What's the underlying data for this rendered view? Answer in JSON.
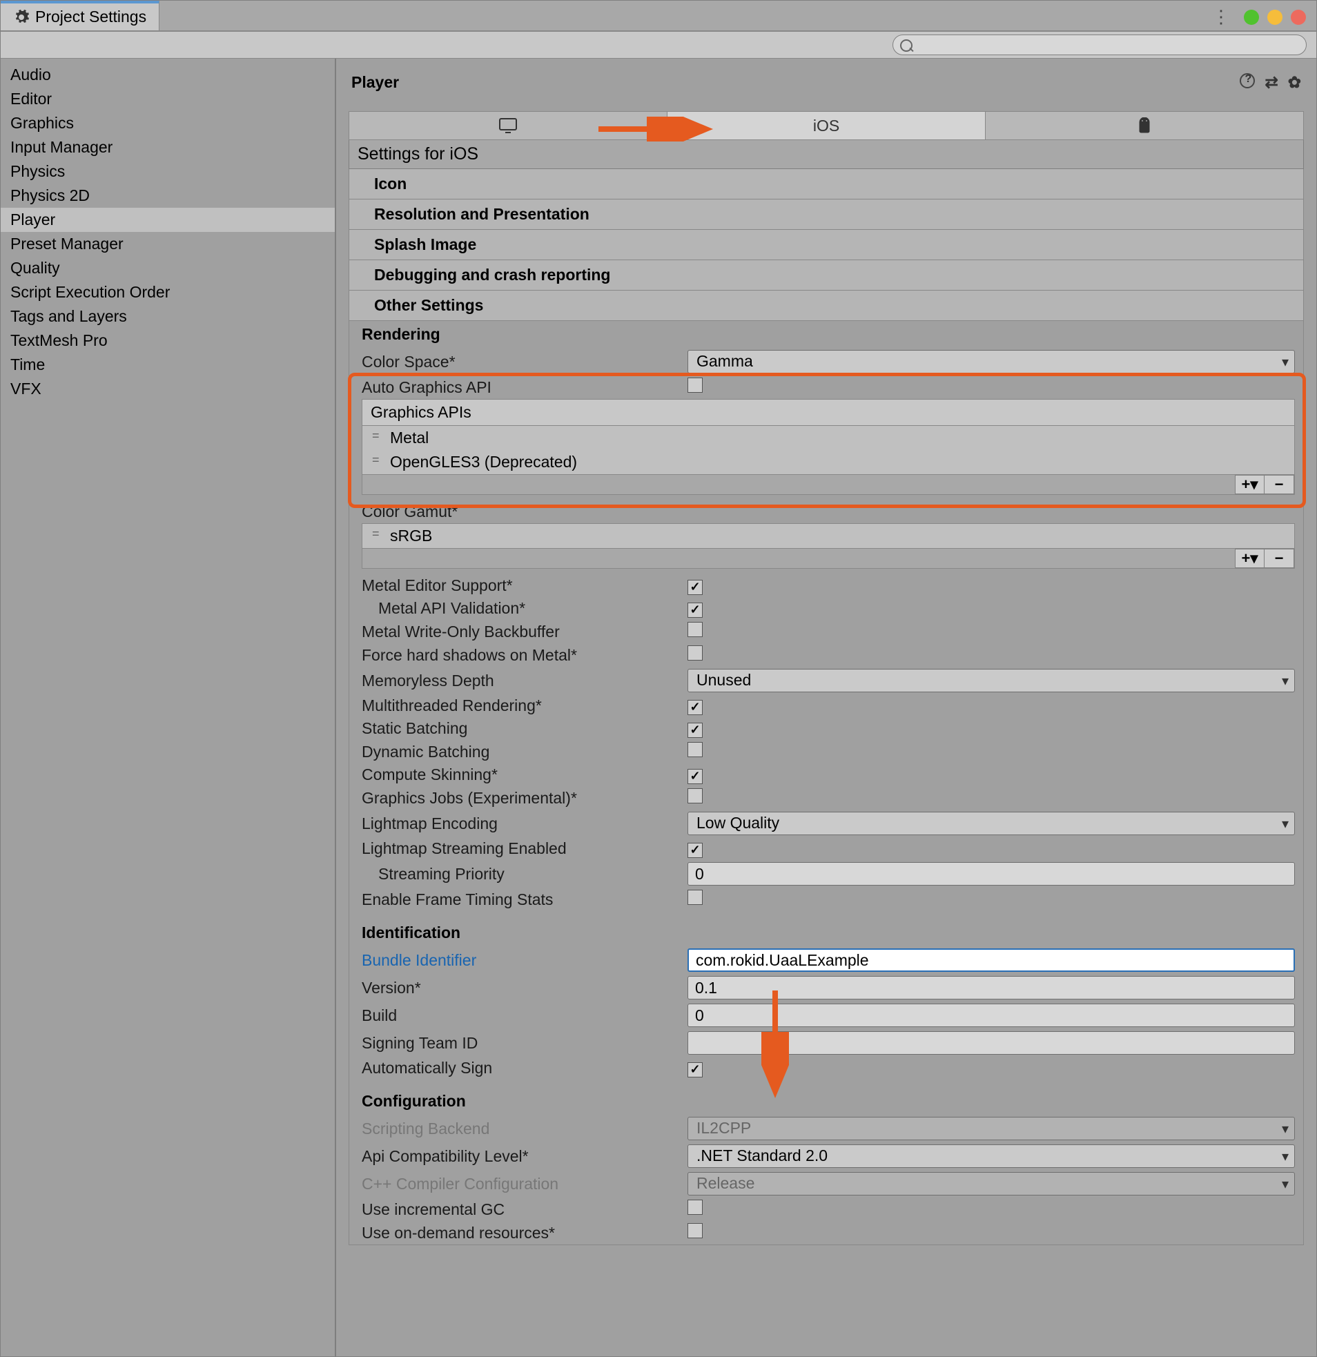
{
  "window": {
    "title": "Project Settings"
  },
  "search": {
    "placeholder": ""
  },
  "sidebar": {
    "items": [
      "Audio",
      "Editor",
      "Graphics",
      "Input Manager",
      "Physics",
      "Physics 2D",
      "Player",
      "Preset Manager",
      "Quality",
      "Script Execution Order",
      "Tags and Layers",
      "TextMesh Pro",
      "Time",
      "VFX"
    ],
    "selected": "Player"
  },
  "main": {
    "title": "Player",
    "platforms": {
      "ios_label": "iOS"
    },
    "settings_for": "Settings for iOS",
    "foldouts": {
      "icon": "Icon",
      "res": "Resolution and Presentation",
      "splash": "Splash Image",
      "debug": "Debugging and crash reporting",
      "other": "Other Settings"
    },
    "other": {
      "rendering_hdr": "Rendering",
      "color_space_lbl": "Color Space*",
      "color_space_val": "Gamma",
      "auto_gfx_lbl": "Auto Graphics API",
      "gfx_apis_hdr": "Graphics APIs",
      "gfx_apis": [
        "Metal",
        "OpenGLES3 (Deprecated)"
      ],
      "color_gamut_lbl": "Color Gamut*",
      "color_gamut_items": [
        "sRGB"
      ],
      "metal_editor_lbl": "Metal Editor Support*",
      "metal_api_val_lbl": "Metal API Validation*",
      "metal_wo_lbl": "Metal Write-Only Backbuffer",
      "force_hard_lbl": "Force hard shadows on Metal*",
      "memless_lbl": "Memoryless Depth",
      "memless_val": "Unused",
      "multith_lbl": "Multithreaded Rendering*",
      "static_batch_lbl": "Static Batching",
      "dyn_batch_lbl": "Dynamic Batching",
      "compute_skin_lbl": "Compute Skinning*",
      "gfx_jobs_lbl": "Graphics Jobs (Experimental)*",
      "lightmap_enc_lbl": "Lightmap Encoding",
      "lightmap_enc_val": "Low Quality",
      "lightmap_stream_lbl": "Lightmap Streaming Enabled",
      "stream_prio_lbl": "Streaming Priority",
      "stream_prio_val": "0",
      "frame_timing_lbl": "Enable Frame Timing Stats",
      "identification_hdr": "Identification",
      "bundle_id_lbl": "Bundle Identifier",
      "bundle_id_val": "com.rokid.UaaLExample",
      "version_lbl": "Version*",
      "version_val": "0.1",
      "build_lbl": "Build",
      "build_val": "0",
      "signing_team_lbl": "Signing Team ID",
      "signing_team_val": "",
      "auto_sign_lbl": "Automatically Sign",
      "config_hdr": "Configuration",
      "script_backend_lbl": "Scripting Backend",
      "script_backend_val": "IL2CPP",
      "api_compat_lbl": "Api Compatibility Level*",
      "api_compat_val": ".NET Standard 2.0",
      "cpp_compiler_lbl": "C++ Compiler Configuration",
      "cpp_compiler_val": "Release",
      "incremental_gc_lbl": "Use incremental GC",
      "ondemand_lbl": "Use on-demand resources*"
    }
  }
}
